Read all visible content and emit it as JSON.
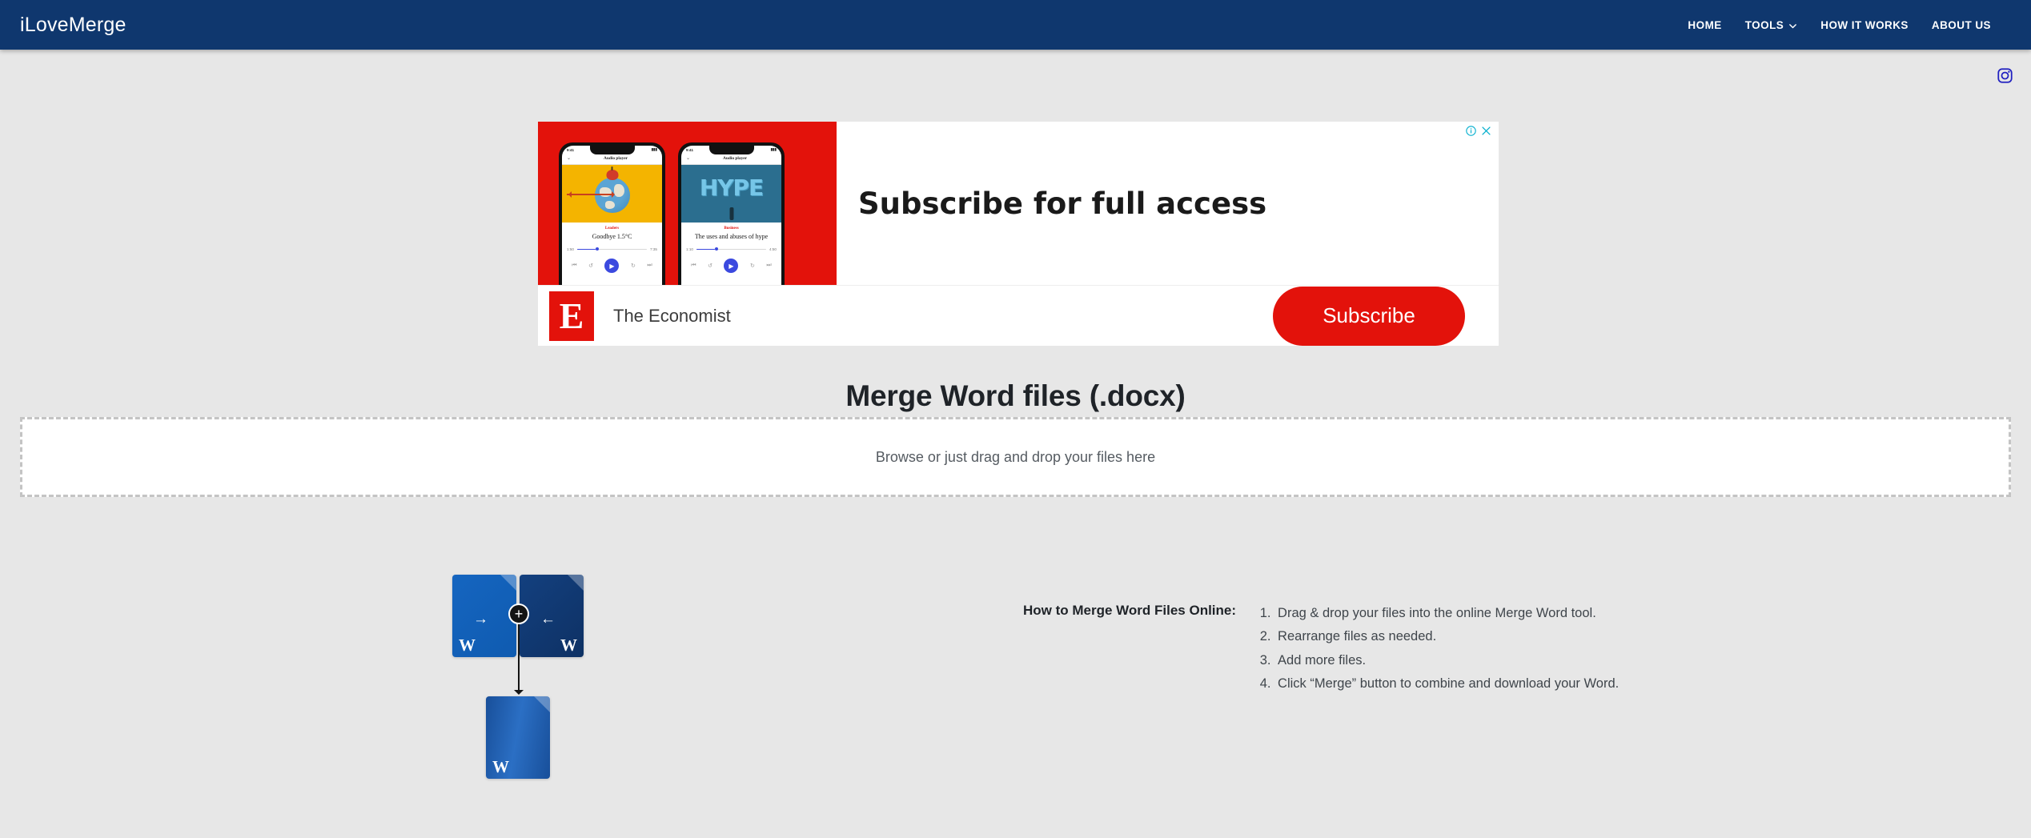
{
  "header": {
    "brand": "iLoveMerge",
    "nav": [
      {
        "label": "HOME",
        "has_chevron": false
      },
      {
        "label": "TOOLS",
        "has_chevron": true
      },
      {
        "label": "HOW IT WORKS",
        "has_chevron": false
      },
      {
        "label": "ABOUT US",
        "has_chevron": false
      }
    ],
    "background_color": "#0f376e"
  },
  "social": {
    "instagram_icon": "instagram-icon",
    "icon_color": "#2020c0"
  },
  "ad": {
    "headline": "Subscribe for full access",
    "advertiser": "The Economist",
    "logo_letter": "E",
    "cta_label": "Subscribe",
    "brand_color": "#e3120b",
    "adchoices_info_icon": "info-icon",
    "adchoices_close_icon": "close-icon",
    "adchoices_color": "#00aecd",
    "phones": [
      {
        "status_time": "9:41",
        "app_title": "Audio player",
        "kicker": "Leaders",
        "track_title": "Goodbye 1.5°C",
        "elapsed": "1:50",
        "duration": "7:35",
        "art": "globe-apple-arrow"
      },
      {
        "status_time": "9:41",
        "app_title": "Audio player",
        "kicker": "Business",
        "track_title": "The uses and abuses of hype",
        "elapsed": "1:10",
        "duration": "4:50",
        "art": "hype-balloons"
      }
    ]
  },
  "main": {
    "title": "Merge Word files (.docx)",
    "dropzone_label": "Browse or just drag and drop your files here"
  },
  "illustration": {
    "doc_letter": "W",
    "arrow_right": "→",
    "arrow_left": "←",
    "plus": "+",
    "source_left_color": "#1565c0",
    "source_right_color": "#13407f",
    "result_color": "#1f5aa8"
  },
  "howto": {
    "heading": "How to Merge Word Files Online:",
    "steps": [
      "Drag & drop your files into the online Merge Word tool.",
      "Rearrange files as needed.",
      "Add more files.",
      "Click “Merge” button to combine and download your Word."
    ]
  }
}
